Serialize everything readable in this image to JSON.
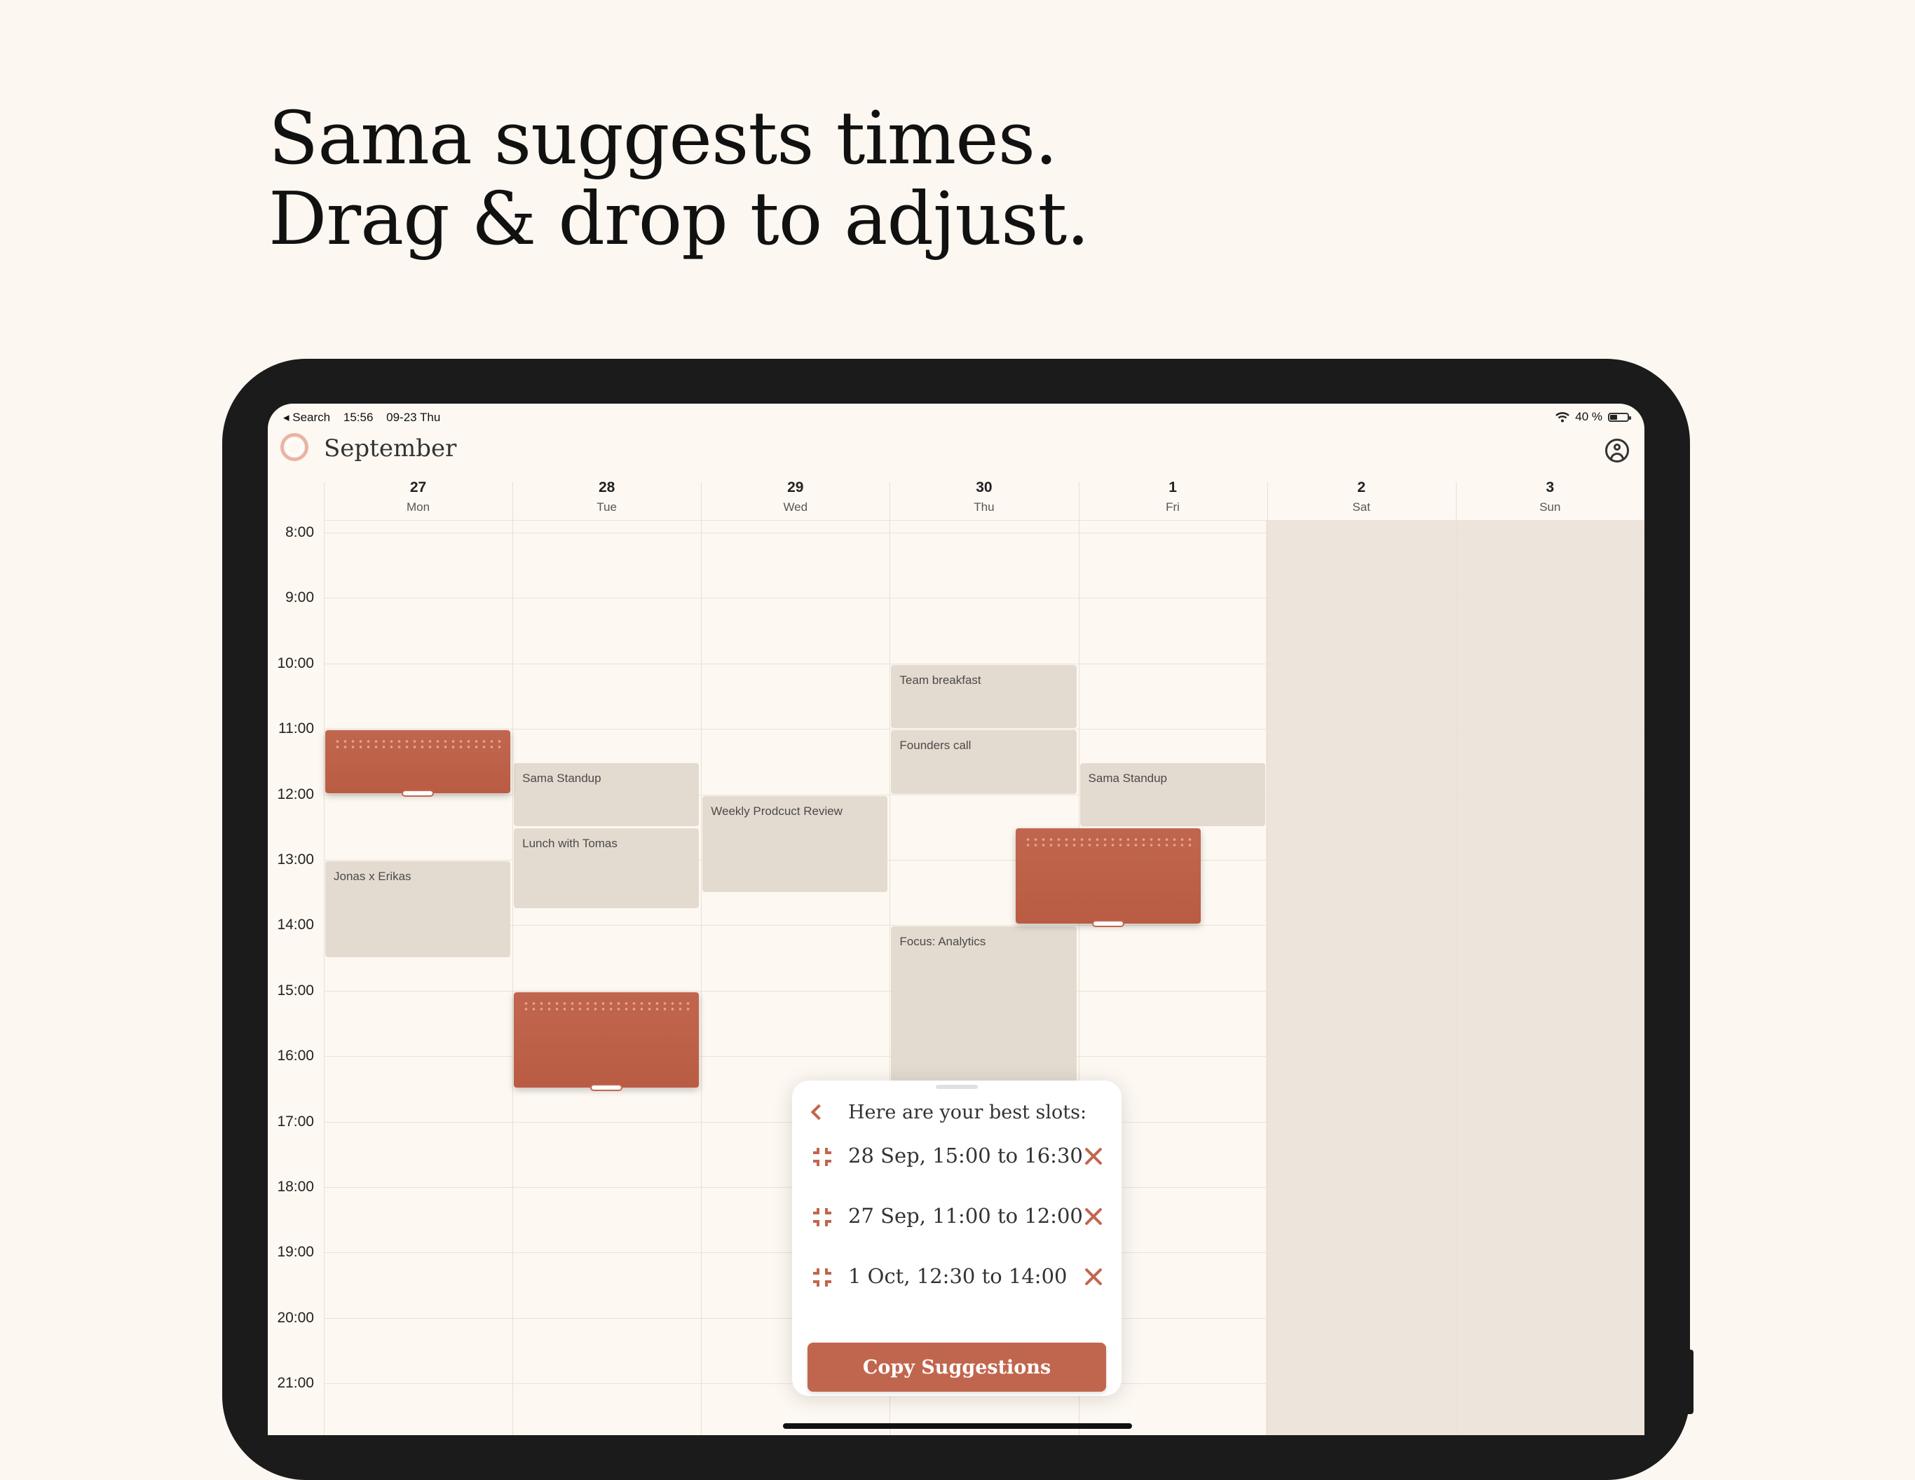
{
  "headline": {
    "line1": "Sama suggests times.",
    "line2": "Drag & drop to adjust."
  },
  "status_bar": {
    "back": "◂ Search",
    "time": "15:56",
    "date": "09-23 Thu",
    "battery": "40 %"
  },
  "calendar": {
    "month": "September",
    "days": [
      {
        "num": "27",
        "wd": "Mon"
      },
      {
        "num": "28",
        "wd": "Tue"
      },
      {
        "num": "29",
        "wd": "Wed"
      },
      {
        "num": "30",
        "wd": "Thu"
      },
      {
        "num": "1",
        "wd": "Fri"
      },
      {
        "num": "2",
        "wd": "Sat"
      },
      {
        "num": "3",
        "wd": "Sun"
      }
    ],
    "hours": [
      "8:00",
      "9:00",
      "10:00",
      "11:00",
      "12:00",
      "13:00",
      "14:00",
      "15:00",
      "16:00",
      "17:00",
      "18:00",
      "19:00",
      "20:00",
      "21:00"
    ],
    "events": [
      {
        "title": "Team breakfast",
        "day": 3,
        "start": "10:00",
        "end": "11:00"
      },
      {
        "title": "Founders call",
        "day": 3,
        "start": "11:00",
        "end": "12:00"
      },
      {
        "title": "Sama Standup",
        "day": 1,
        "start": "11:30",
        "end": "12:30"
      },
      {
        "title": "Sama Standup",
        "day": 4,
        "start": "11:30",
        "end": "12:30"
      },
      {
        "title": "Lunch with Tomas",
        "day": 1,
        "start": "12:30",
        "end": "13:45"
      },
      {
        "title": "Weekly Prodcuct Review",
        "day": 2,
        "start": "12:00",
        "end": "13:30"
      },
      {
        "title": "Jonas x Erikas",
        "day": 0,
        "start": "13:00",
        "end": "14:30"
      },
      {
        "title": "Focus: Analytics",
        "day": 3,
        "start": "14:00",
        "end": "16:30"
      }
    ],
    "suggested_slots": [
      {
        "day": 0,
        "start": "11:00",
        "end": "12:00"
      },
      {
        "day": 1,
        "start": "15:00",
        "end": "16:30"
      },
      {
        "day": 4,
        "start": "12:30",
        "end": "14:00"
      }
    ]
  },
  "suggestions_panel": {
    "title": "Here are your best slots:",
    "slots": [
      "28 Sep, 15:00 to 16:30",
      "27 Sep, 11:00 to 12:00",
      "1 Oct, 12:30 to 14:00"
    ],
    "copy_label": "Copy Suggestions"
  },
  "colors": {
    "accent": "#c1664e",
    "background": "#fdf8f2",
    "event": "#e4dbd0",
    "weekend": "#ede5dc"
  }
}
